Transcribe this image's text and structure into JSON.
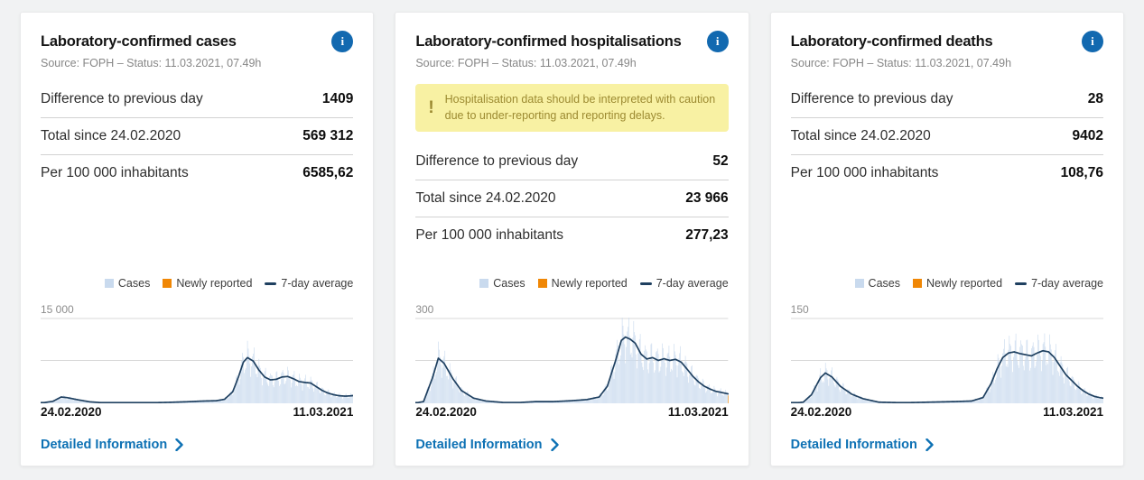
{
  "page": {
    "background": "#f1f2f3"
  },
  "colors": {
    "link_blue": "#0d71b4",
    "info_icon_bg": "#1269b0",
    "bar_light_blue": "#c9daee",
    "newly_reported_orange": "#f08705",
    "avg_line_navy": "#1f4060",
    "gridline_gray": "#d8d8d8",
    "warning_bg": "#f8f1a3",
    "warning_text": "#9c8a31"
  },
  "icons": {
    "info_glyph": "i",
    "warning_glyph": "!"
  },
  "legend": {
    "cases_label": "Cases",
    "newly_reported_label": "Newly reported",
    "seven_day_average_label": "7-day average"
  },
  "link_label": "Detailed Information",
  "cards": [
    {
      "title": "Laboratory-confirmed cases",
      "source": "Source: FOPH – Status: 11.03.2021, 07.49h",
      "stats": [
        {
          "label": "Difference to previous day",
          "value": "1409"
        },
        {
          "label": "Total since 24.02.2020",
          "value": "569 312"
        },
        {
          "label": "Per 100 000 inhabitants",
          "value": "6585,62"
        }
      ]
    },
    {
      "title": "Laboratory-confirmed hospitalisations",
      "source": "Source: FOPH – Status: 11.03.2021, 07.49h",
      "warning": {
        "text": "Hospitalisation data should be interpreted with caution due to under-reporting and reporting delays."
      },
      "stats": [
        {
          "label": "Difference to previous day",
          "value": "52"
        },
        {
          "label": "Total since 24.02.2020",
          "value": "23 966"
        },
        {
          "label": "Per 100 000 inhabitants",
          "value": "277,23"
        }
      ]
    },
    {
      "title": "Laboratory-confirmed deaths",
      "source": "Source: FOPH – Status: 11.03.2021, 07.49h",
      "stats": [
        {
          "label": "Difference to previous day",
          "value": "28"
        },
        {
          "label": "Total since 24.02.2020",
          "value": "9402"
        },
        {
          "label": "Per 100 000 inhabitants",
          "value": "108,76"
        }
      ]
    }
  ],
  "chart_data": [
    {
      "type": "area",
      "title": "Laboratory-confirmed cases – daily values with 7-day average",
      "x_start_label": "24.02.2020",
      "x_end_label": "11.03.2021",
      "total_days": 381,
      "ymax": 15000,
      "ymax_label": "15 000",
      "gridlines": [
        15000,
        7500
      ],
      "legend_position": "top-right",
      "series": [
        {
          "name": "Cases",
          "type": "bar",
          "note": "daily reported values shown as light-blue bars oscillating around the 7-day average"
        },
        {
          "name": "Newly reported",
          "type": "bar",
          "note": "most recent day, orange"
        },
        {
          "name": "7-day average",
          "type": "line",
          "points": [
            [
              0,
              30
            ],
            [
              15,
              350
            ],
            [
              25,
              1100
            ],
            [
              32,
              1000
            ],
            [
              46,
              600
            ],
            [
              60,
              260
            ],
            [
              76,
              90
            ],
            [
              98,
              35
            ],
            [
              117,
              30
            ],
            [
              137,
              110
            ],
            [
              159,
              180
            ],
            [
              178,
              270
            ],
            [
              199,
              400
            ],
            [
              214,
              450
            ],
            [
              224,
              700
            ],
            [
              234,
              2000
            ],
            [
              241,
              4600
            ],
            [
              247,
              7200
            ],
            [
              252,
              8000
            ],
            [
              259,
              7400
            ],
            [
              266,
              5800
            ],
            [
              273,
              4600
            ],
            [
              280,
              4100
            ],
            [
              287,
              4200
            ],
            [
              294,
              4600
            ],
            [
              301,
              4700
            ],
            [
              308,
              4300
            ],
            [
              315,
              3800
            ],
            [
              322,
              3650
            ],
            [
              329,
              3550
            ],
            [
              336,
              2900
            ],
            [
              343,
              2250
            ],
            [
              350,
              1800
            ],
            [
              357,
              1500
            ],
            [
              364,
              1320
            ],
            [
              371,
              1250
            ],
            [
              377,
              1300
            ],
            [
              381,
              1350
            ]
          ]
        }
      ]
    },
    {
      "type": "area",
      "title": "Laboratory-confirmed hospitalisations – daily values with 7-day average",
      "x_start_label": "24.02.2020",
      "x_end_label": "11.03.2021",
      "total_days": 381,
      "ymax": 300,
      "ymax_label": "300",
      "gridlines": [
        300,
        150
      ],
      "legend_position": "top-right",
      "series": [
        {
          "name": "Cases",
          "type": "bar",
          "note": "daily reported values shown as light-blue bars oscillating around the 7-day average"
        },
        {
          "name": "Newly reported",
          "type": "bar",
          "note": "most recent day, orange"
        },
        {
          "name": "7-day average",
          "type": "line",
          "points": [
            [
              0,
              1
            ],
            [
              10,
              6
            ],
            [
              21,
              90
            ],
            [
              28,
              158
            ],
            [
              35,
              140
            ],
            [
              46,
              85
            ],
            [
              56,
              45
            ],
            [
              71,
              18
            ],
            [
              86,
              8
            ],
            [
              107,
              3
            ],
            [
              128,
              3
            ],
            [
              147,
              6
            ],
            [
              168,
              6
            ],
            [
              190,
              9
            ],
            [
              209,
              13
            ],
            [
              224,
              22
            ],
            [
              234,
              60
            ],
            [
              244,
              150
            ],
            [
              251,
              220
            ],
            [
              256,
              232
            ],
            [
              262,
              224
            ],
            [
              268,
              210
            ],
            [
              275,
              172
            ],
            [
              282,
              155
            ],
            [
              289,
              160
            ],
            [
              296,
              150
            ],
            [
              303,
              156
            ],
            [
              310,
              150
            ],
            [
              317,
              154
            ],
            [
              324,
              144
            ],
            [
              331,
              120
            ],
            [
              338,
              95
            ],
            [
              345,
              75
            ],
            [
              352,
              60
            ],
            [
              359,
              50
            ],
            [
              366,
              42
            ],
            [
              373,
              38
            ],
            [
              381,
              33
            ]
          ]
        }
      ]
    },
    {
      "type": "area",
      "title": "Laboratory-confirmed deaths – daily values with 7-day average",
      "x_start_label": "24.02.2020",
      "x_end_label": "11.03.2021",
      "total_days": 381,
      "ymax": 150,
      "ymax_label": "150",
      "gridlines": [
        150,
        75
      ],
      "legend_position": "top-right",
      "series": [
        {
          "name": "Cases",
          "type": "bar",
          "note": "daily reported values shown as light-blue bars oscillating around the 7-day average"
        },
        {
          "name": "Newly reported",
          "type": "bar",
          "note": "most recent day, orange"
        },
        {
          "name": "7-day average",
          "type": "line",
          "points": [
            [
              0,
              0
            ],
            [
              15,
              2
            ],
            [
              25,
              15
            ],
            [
              36,
              45
            ],
            [
              42,
              53
            ],
            [
              50,
              46
            ],
            [
              60,
              30
            ],
            [
              74,
              16
            ],
            [
              88,
              8
            ],
            [
              107,
              2
            ],
            [
              137,
              1
            ],
            [
              168,
              2
            ],
            [
              199,
              3
            ],
            [
              220,
              4
            ],
            [
              234,
              10
            ],
            [
              244,
              35
            ],
            [
              251,
              60
            ],
            [
              258,
              80
            ],
            [
              265,
              88
            ],
            [
              272,
              90
            ],
            [
              279,
              87
            ],
            [
              286,
              85
            ],
            [
              293,
              83
            ],
            [
              300,
              88
            ],
            [
              307,
              92
            ],
            [
              314,
              90
            ],
            [
              321,
              80
            ],
            [
              328,
              65
            ],
            [
              335,
              50
            ],
            [
              342,
              40
            ],
            [
              349,
              30
            ],
            [
              356,
              22
            ],
            [
              363,
              16
            ],
            [
              370,
              12
            ],
            [
              376,
              10
            ],
            [
              381,
              9
            ]
          ]
        }
      ]
    }
  ]
}
